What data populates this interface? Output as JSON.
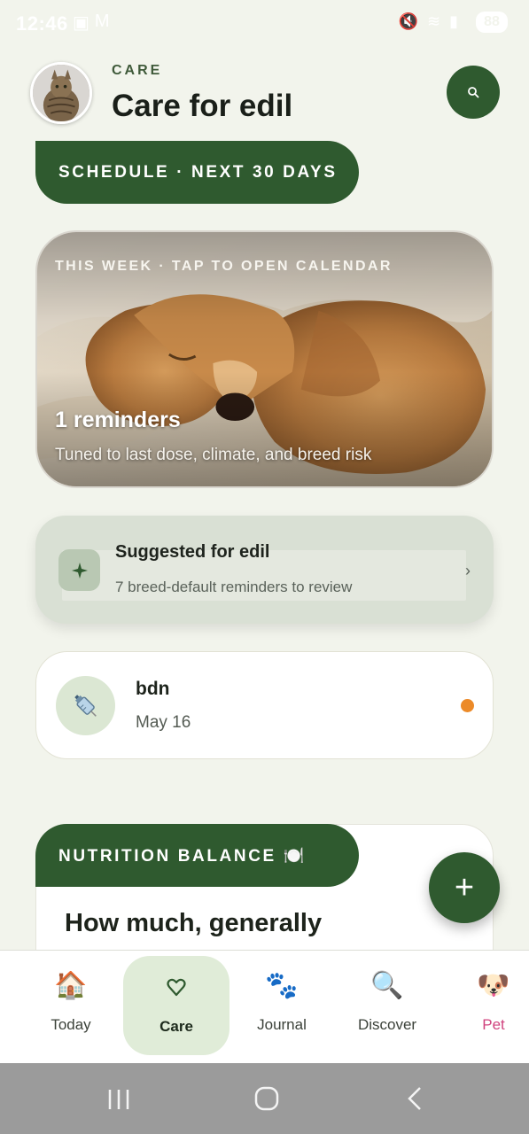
{
  "status_bar": {
    "time": "12:46",
    "battery": "88"
  },
  "header": {
    "kicker": "CARE",
    "title": "Care for edil"
  },
  "schedule_banner": "SCHEDULE · NEXT 30 DAYS",
  "hero": {
    "kicker": "THIS WEEK · TAP TO OPEN CALENDAR",
    "title": "1 reminders",
    "subtitle": "Tuned to last dose, climate, and breed risk"
  },
  "suggested": {
    "title": "Suggested for edil",
    "subtitle": "7 breed-default reminders to review",
    "chevron": "›"
  },
  "reminder": {
    "title": "bdn",
    "date": "May 16",
    "icon": "syringe-icon",
    "dot_color": "#ec8a28"
  },
  "nutrition": {
    "banner": "NUTRITION BALANCE 🍽️",
    "heading": "How much, generally"
  },
  "fab_label": "+",
  "bottom_nav": [
    {
      "label": "Today",
      "icon": "🏠"
    },
    {
      "label": "Care",
      "icon": "♡"
    },
    {
      "label": "Journal",
      "icon": "🐾"
    },
    {
      "label": "Discover",
      "icon": "🔍"
    },
    {
      "label": "Pet",
      "icon": "🐶"
    }
  ],
  "colors": {
    "primary": "#2f5a2f",
    "background": "#f2f4ec",
    "active_nav": "#e0ecd8",
    "pet_label": "#d0437e"
  }
}
